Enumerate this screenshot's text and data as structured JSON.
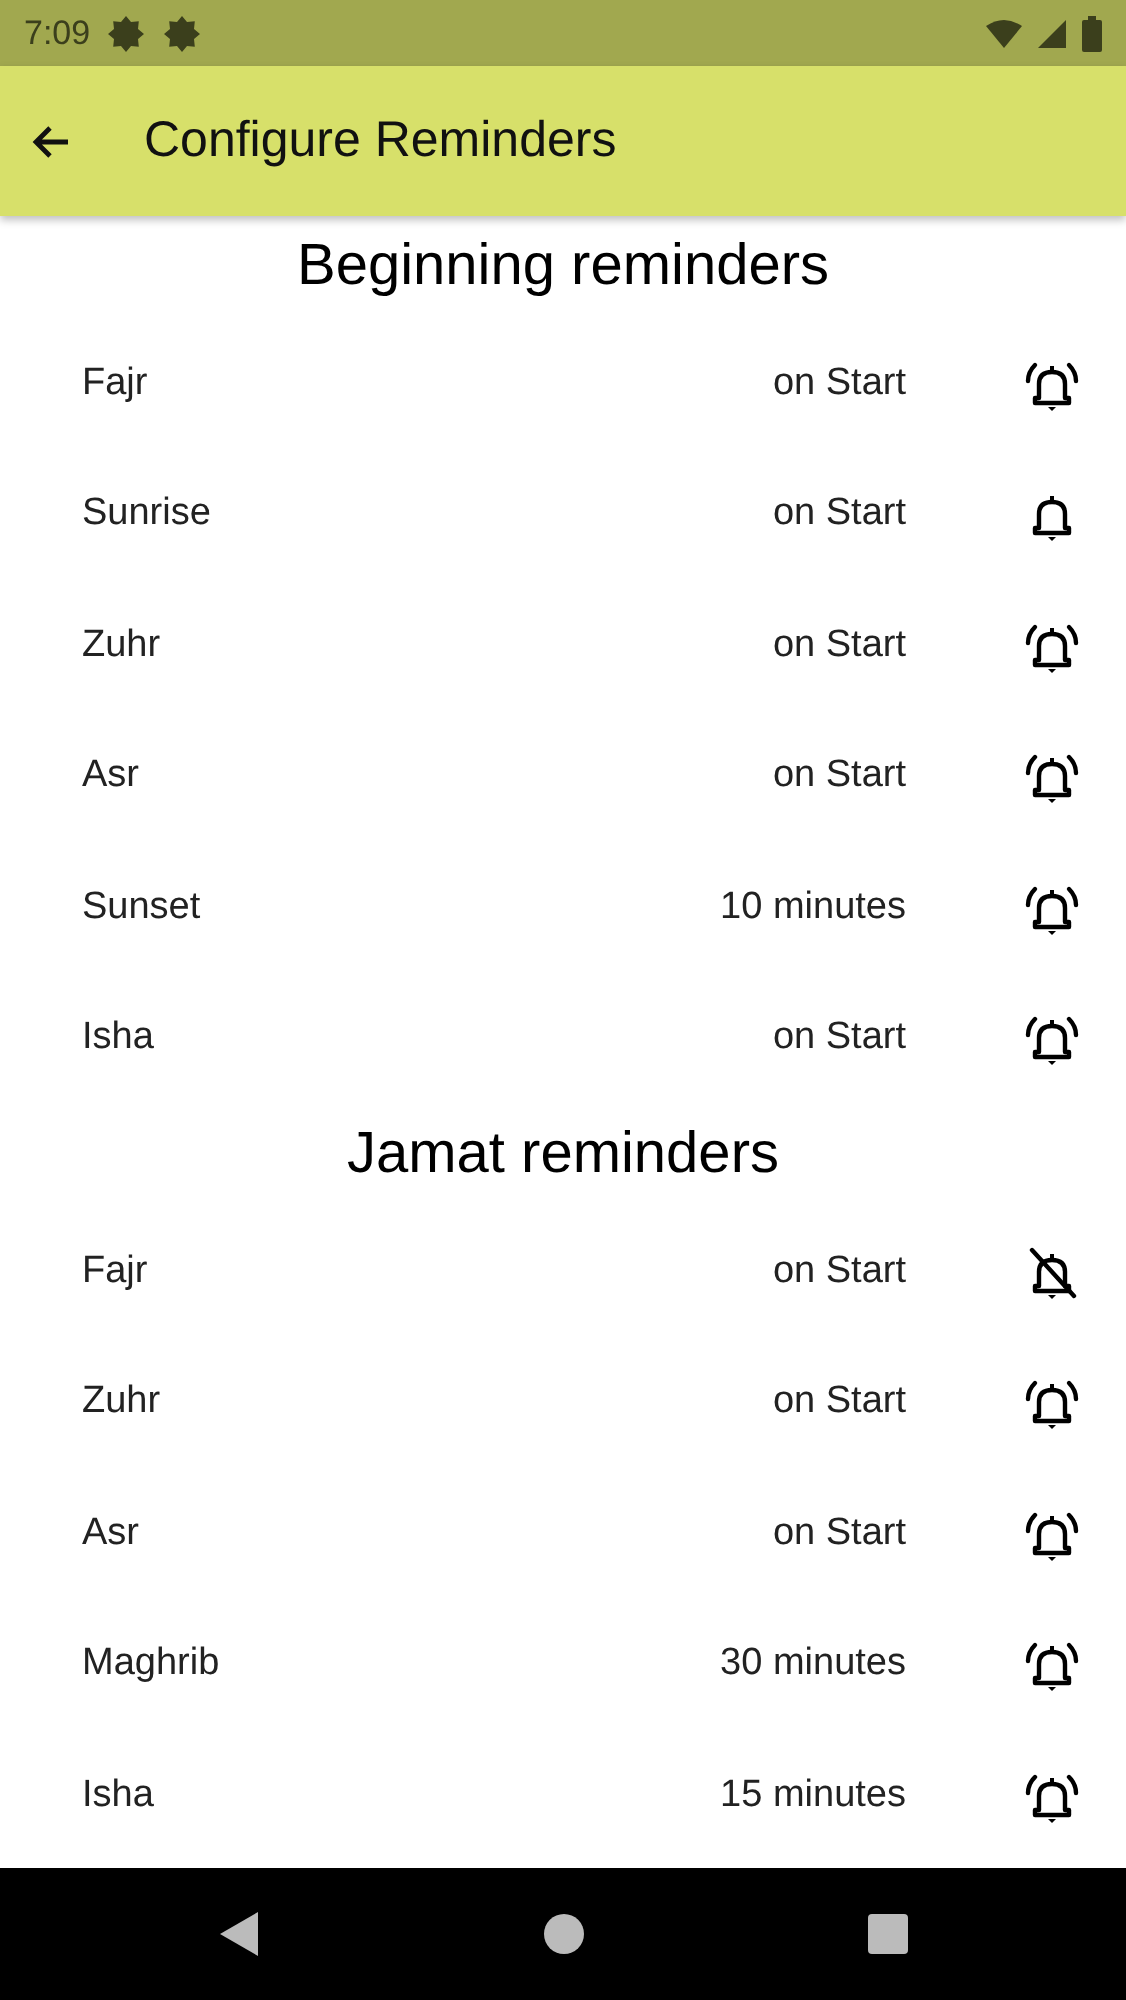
{
  "status_bar": {
    "time": "7:09"
  },
  "app_bar": {
    "title": "Configure Reminders"
  },
  "sections": [
    {
      "title": "Beginning reminders",
      "reminders": [
        {
          "prayer": "Fajr",
          "timing": "on Start",
          "kind": "ringing"
        },
        {
          "prayer": "Sunrise",
          "timing": "on Start",
          "kind": "plain"
        },
        {
          "prayer": "Zuhr",
          "timing": "on Start",
          "kind": "ringing"
        },
        {
          "prayer": "Asr",
          "timing": "on Start",
          "kind": "ringing"
        },
        {
          "prayer": "Sunset",
          "timing": "10 minutes",
          "kind": "ringing"
        },
        {
          "prayer": "Isha",
          "timing": "on Start",
          "kind": "ringing"
        }
      ]
    },
    {
      "title": "Jamat reminders",
      "reminders": [
        {
          "prayer": "Fajr",
          "timing": "on Start",
          "kind": "off"
        },
        {
          "prayer": "Zuhr",
          "timing": "on Start",
          "kind": "ringing"
        },
        {
          "prayer": "Asr",
          "timing": "on Start",
          "kind": "ringing"
        },
        {
          "prayer": "Maghrib",
          "timing": "30 minutes",
          "kind": "ringing"
        },
        {
          "prayer": "Isha",
          "timing": "15 minutes",
          "kind": "ringing"
        }
      ]
    }
  ]
}
